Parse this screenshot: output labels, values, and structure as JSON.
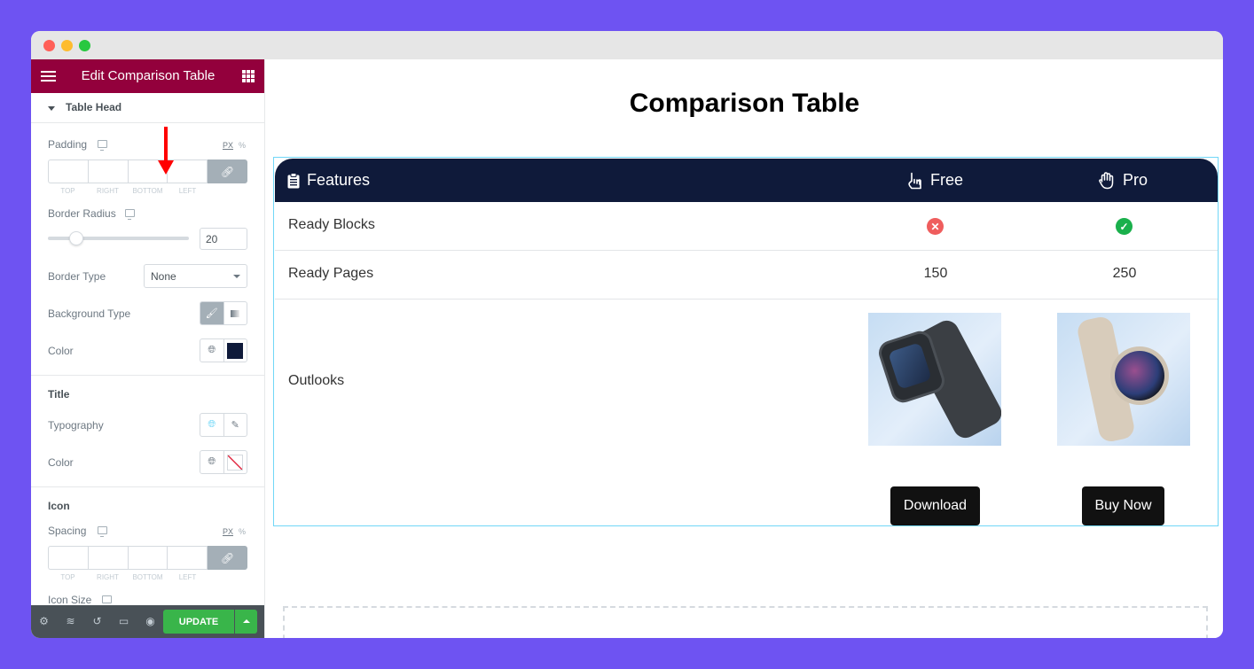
{
  "window": {
    "traffic_lights": [
      "close",
      "minimize",
      "maximize"
    ]
  },
  "sidebar": {
    "header_title": "Edit Comparison Table",
    "menu_icon": "hamburger-icon",
    "widgets_icon": "grid-icon",
    "section": "Table Head",
    "padding": {
      "label": "Padding",
      "unit_px": "PX",
      "unit_pct": "%",
      "fields": [
        "TOP",
        "RIGHT",
        "BOTTOM",
        "LEFT"
      ],
      "values": [
        "",
        "",
        "",
        ""
      ]
    },
    "border_radius": {
      "label": "Border Radius",
      "value": "20",
      "slider_fraction": 0.2
    },
    "border_type": {
      "label": "Border Type",
      "selected": "None"
    },
    "background_type": {
      "label": "Background Type",
      "options": [
        "classic",
        "gradient"
      ],
      "active": "classic"
    },
    "head_color": {
      "label": "Color",
      "value": "#0f1a3a"
    },
    "title_section": {
      "heading": "Title",
      "typography_label": "Typography",
      "color_label": "Color"
    },
    "icon_section": {
      "heading": "Icon",
      "spacing_label": "Spacing",
      "unit_px": "PX",
      "unit_pct": "%",
      "fields": [
        "TOP",
        "RIGHT",
        "BOTTOM",
        "LEFT"
      ],
      "icon_size_label": "Icon Size"
    },
    "footer": {
      "icons": [
        "settings-icon",
        "layers-icon",
        "history-icon",
        "responsive-icon",
        "preview-icon"
      ],
      "update_label": "UPDATE"
    }
  },
  "canvas": {
    "page_title": "Comparison Table",
    "table": {
      "head_color": "#0f1a3a",
      "columns": [
        {
          "label": "Features",
          "icon": "clipboard-icon"
        },
        {
          "label": "Free",
          "icon": "hand-pointer-icon"
        },
        {
          "label": "Pro",
          "icon": "hand-paper-icon"
        }
      ],
      "rows": [
        {
          "feature": "Ready Blocks",
          "free": "no",
          "pro": "yes"
        },
        {
          "feature": "Ready Pages",
          "free": "150",
          "pro": "250"
        },
        {
          "feature": "Outlooks",
          "free": "dark-watch-image",
          "pro": "beige-watch-image"
        }
      ],
      "buttons": {
        "free": "Download",
        "pro": "Buy Now"
      }
    }
  }
}
